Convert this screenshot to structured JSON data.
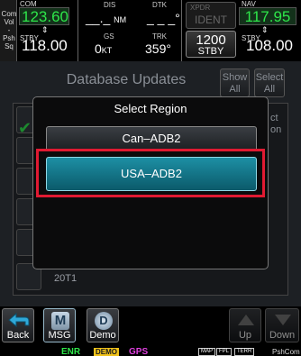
{
  "knob": {
    "lines": [
      "Com",
      "Vol",
      "-",
      "Psh",
      "Sq"
    ]
  },
  "com": {
    "label": "COM",
    "active": "123.60",
    "stby_label": "STBY",
    "standby": "118.00"
  },
  "navinfo": {
    "dis_label": "DIS",
    "dis_value": "__._",
    "dis_unit": "NM",
    "dtk_label": "DTK",
    "dtk_value": "_ _ _",
    "dtk_unit": "°",
    "gs_label": "GS",
    "gs_value": "0",
    "gs_unit": "KT",
    "trk_label": "TRK",
    "trk_value": "359",
    "trk_unit": "°"
  },
  "xpdr": {
    "label": "XPDR",
    "ident": "IDENT",
    "code": "1200",
    "mode": "STBY"
  },
  "nav": {
    "label": "NAV",
    "active": "117.95",
    "stby_label": "STBY",
    "standby": "108.00"
  },
  "page": {
    "title": "Database Updates",
    "show_all": [
      "Show",
      "All"
    ],
    "select_all": [
      "Select",
      "All"
    ],
    "row_label": "20T1",
    "partial": [
      "ct",
      "on"
    ]
  },
  "modal": {
    "title": "Select Region",
    "options": [
      "Can–ADB2",
      "USA–ADB2"
    ]
  },
  "bottom": {
    "back": "Back",
    "msg": "MSG",
    "msg_glyph": "M",
    "demo": "Demo",
    "demo_glyph": "D",
    "up": "Up",
    "down": "Down"
  },
  "annunciators": {
    "enr": "ENR",
    "demo": "DEMO",
    "gps": "GPS",
    "chips": [
      "MAP",
      "FPL",
      "TERR"
    ],
    "hint": "PshCom"
  },
  "colors": {
    "active_freq": "#2ee64a",
    "selected_option": "#1d8fa4",
    "highlight": "#e01a32"
  }
}
